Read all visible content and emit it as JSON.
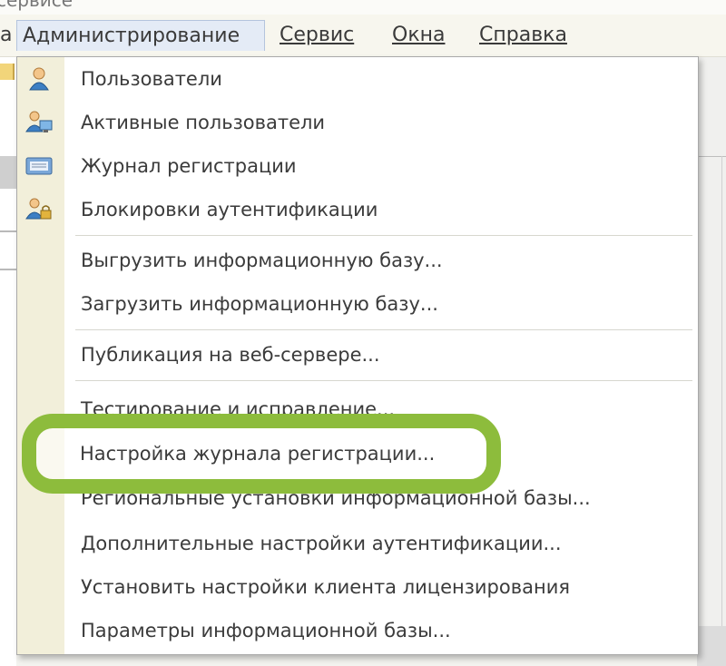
{
  "window": {
    "title_fragment": "сервисе"
  },
  "menubar": {
    "items": [
      {
        "label": "а"
      },
      {
        "label": "Администрирование",
        "active": true
      },
      {
        "label": "Сервис"
      },
      {
        "label": "Окна"
      },
      {
        "label": "Справка"
      }
    ]
  },
  "dropdown": {
    "items": [
      {
        "label": "Пользователи",
        "icon": "user-icon"
      },
      {
        "label": "Активные пользователи",
        "icon": "active-users-icon"
      },
      {
        "label": "Журнал регистрации",
        "icon": "event-log-icon"
      },
      {
        "label": "Блокировки аутентификации",
        "icon": "user-lock-icon"
      },
      {
        "label": "Выгрузить информационную базу..."
      },
      {
        "label": "Загрузить информационную базу..."
      },
      {
        "label": "Публикация на веб-сервере..."
      },
      {
        "label": "Тестирование и исправление..."
      },
      {
        "label": "Настройка журнала регистрации...",
        "highlighted": true
      },
      {
        "label": "Региональные установки информационной базы..."
      },
      {
        "label": "Дополнительные настройки аутентификации..."
      },
      {
        "label": "Установить настройки клиента лицензирования"
      },
      {
        "label": "Параметры информационной базы..."
      }
    ]
  },
  "colors": {
    "highlight_ring": "#8dbc3c",
    "menu_gutter": "#f2efda",
    "active_menu_bg": "#e4ebf6"
  }
}
